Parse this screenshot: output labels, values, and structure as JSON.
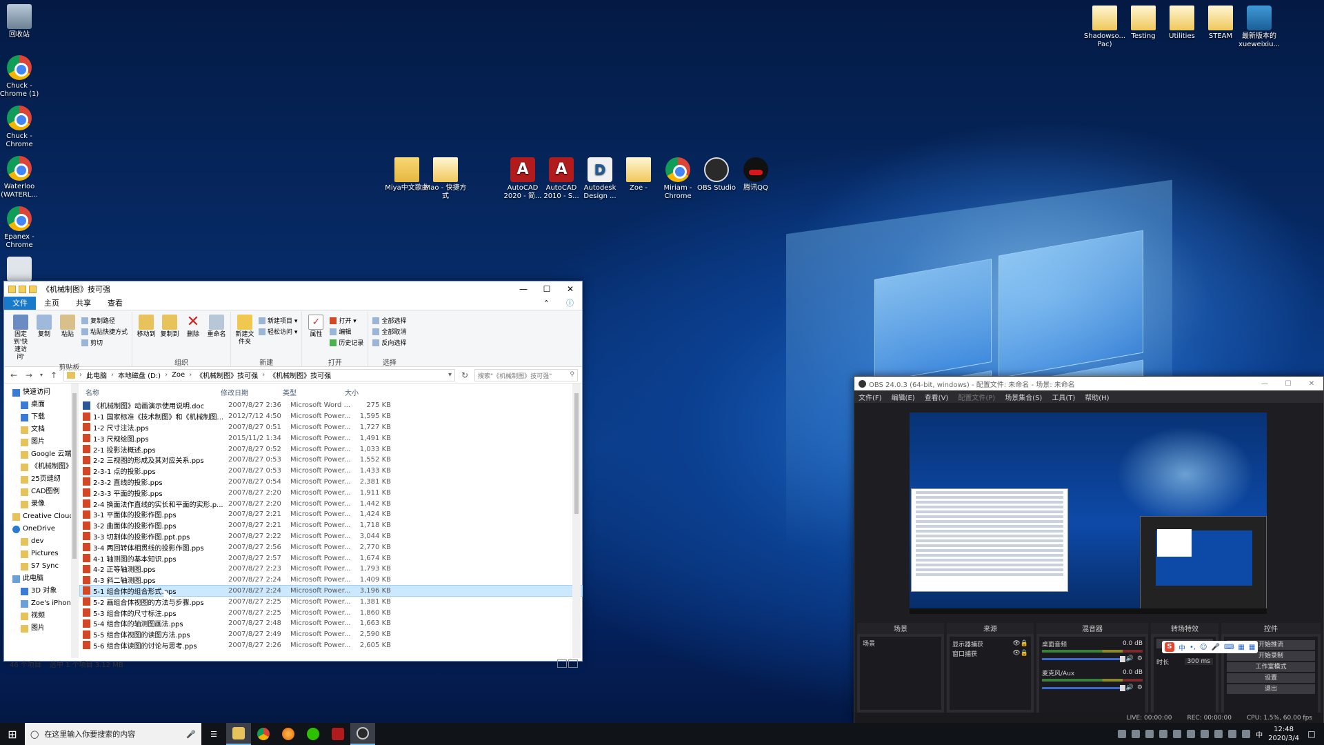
{
  "desktop_left": [
    {
      "label": "回收站",
      "icon": "recycle-bin-icon",
      "kind": "recycle"
    },
    {
      "label": "Chuck - Chrome (1)",
      "icon": "chrome-icon",
      "kind": "chrome"
    },
    {
      "label": "Chuck - Chrome",
      "icon": "chrome-icon",
      "kind": "chrome"
    },
    {
      "label": "Waterloo (WATERL...",
      "icon": "chrome-icon",
      "kind": "chrome"
    },
    {
      "label": "Epanex - Chrome",
      "icon": "chrome-icon",
      "kind": "chrome"
    },
    {
      "label": "",
      "icon": "settings-shortcut-icon",
      "kind": "gear"
    }
  ],
  "desktop_middle": [
    {
      "label": "Miya中文歌曲",
      "icon": "folder-icon",
      "kind": "folder"
    },
    {
      "label": "Mao - 快捷方式",
      "icon": "folder-shortcut-icon",
      "kind": "file"
    },
    {
      "label": "AutoCAD 2020 - 简...",
      "icon": "autocad-icon",
      "kind": "acad",
      "glyph": "A"
    },
    {
      "label": "AutoCAD 2010 - S...",
      "icon": "autocad-icon",
      "kind": "acad",
      "glyph": "A"
    },
    {
      "label": "Autodesk Design ...",
      "icon": "autodesk-design-review-icon",
      "kind": "rev",
      "glyph": "D"
    },
    {
      "label": "Zoe -",
      "icon": "folder-shortcut-icon",
      "kind": "file"
    },
    {
      "label": "Miriam - Chrome",
      "icon": "chrome-icon",
      "kind": "chrome"
    },
    {
      "label": "OBS Studio",
      "icon": "obs-icon",
      "kind": "obs"
    },
    {
      "label": "腾讯QQ",
      "icon": "qq-icon",
      "kind": "qq"
    }
  ],
  "desktop_right": [
    {
      "label": "Shadowso... Pac)",
      "icon": "folder-icon",
      "kind": "file"
    },
    {
      "label": "Testing",
      "icon": "folder-icon",
      "kind": "file"
    },
    {
      "label": "Utilities",
      "icon": "folder-icon",
      "kind": "file"
    },
    {
      "label": "STEAM",
      "icon": "folder-icon",
      "kind": "file"
    },
    {
      "label": "最新版本的xueweixiu...",
      "icon": "video-file-icon",
      "kind": "video"
    }
  ],
  "explorer": {
    "title": "《机械制图》技可强",
    "tabs": {
      "file": "文件",
      "home": "主页",
      "share": "共享",
      "view": "查看"
    },
    "ribbon": {
      "pin": "固定到'快速访问'",
      "copy": "复制",
      "paste": "粘贴",
      "copy_path": "复制路径",
      "paste_shortcut": "粘贴快捷方式",
      "cut": "剪切",
      "clipboard": "剪贴板",
      "move_to": "移动到",
      "copy_to": "复制到",
      "delete": "删除",
      "rename": "重命名",
      "organize": "组织",
      "new_folder": "新建文件夹",
      "new_item": "新建项目 ▾",
      "easy_access": "轻松访问 ▾",
      "new": "新建",
      "properties": "属性",
      "open": "打开 ▾",
      "edit": "编辑",
      "history": "历史记录",
      "open_group": "打开",
      "select_all": "全部选择",
      "select_none": "全部取消",
      "invert": "反向选择",
      "select": "选择"
    },
    "address": [
      "此电脑",
      "本地磁盘 (D:)",
      "Zoe",
      "《机械制图》技可强",
      "《机械制图》技可强"
    ],
    "search_placeholder": "搜索\"《机械制图》技可强\"",
    "nav": [
      {
        "label": "快速访问",
        "sub": false,
        "i": "blue"
      },
      {
        "label": "桌面",
        "sub": true,
        "i": "blue"
      },
      {
        "label": "下载",
        "sub": true,
        "i": "blue"
      },
      {
        "label": "文档",
        "sub": true,
        "i": ""
      },
      {
        "label": "图片",
        "sub": true,
        "i": ""
      },
      {
        "label": "Google 云端",
        "sub": true,
        "i": ""
      },
      {
        "label": "《机械制图》技",
        "sub": true,
        "i": ""
      },
      {
        "label": "25页缝纫",
        "sub": true,
        "i": ""
      },
      {
        "label": "CAD图例",
        "sub": true,
        "i": ""
      },
      {
        "label": "录像",
        "sub": true,
        "i": ""
      },
      {
        "label": "Creative Cloud F",
        "sub": false,
        "i": ""
      },
      {
        "label": "OneDrive",
        "sub": false,
        "i": "cloud"
      },
      {
        "label": "dev",
        "sub": true,
        "i": ""
      },
      {
        "label": "Pictures",
        "sub": true,
        "i": ""
      },
      {
        "label": "S7 Sync",
        "sub": true,
        "i": ""
      },
      {
        "label": "此电脑",
        "sub": false,
        "i": "pc"
      },
      {
        "label": "3D 对象",
        "sub": true,
        "i": "blue"
      },
      {
        "label": "Zoe's iPhone",
        "sub": true,
        "i": "pc"
      },
      {
        "label": "视频",
        "sub": true,
        "i": ""
      },
      {
        "label": "图片",
        "sub": true,
        "i": ""
      }
    ],
    "columns": {
      "name": "名称",
      "modified": "修改日期",
      "type": "类型",
      "size": "大小"
    },
    "files": [
      {
        "name": "《机械制图》动画演示使用说明.doc",
        "date": "2007/8/27 2:36",
        "type": "Microsoft Word ...",
        "size": "275 KB",
        "doc": true
      },
      {
        "name": "1-1 国家标准《技术制图》和《机械制图...",
        "date": "2012/7/12 4:50",
        "type": "Microsoft Power...",
        "size": "1,595 KB"
      },
      {
        "name": "1-2 尺寸注法.pps",
        "date": "2007/8/27 0:51",
        "type": "Microsoft Power...",
        "size": "1,727 KB"
      },
      {
        "name": "1-3 尺规绘图.pps",
        "date": "2015/11/2 1:34",
        "type": "Microsoft Power...",
        "size": "1,491 KB"
      },
      {
        "name": "2-1 投影法概述.pps",
        "date": "2007/8/27 0:52",
        "type": "Microsoft Power...",
        "size": "1,033 KB"
      },
      {
        "name": "2-2 三视图的形成及其对应关系.pps",
        "date": "2007/8/27 0:53",
        "type": "Microsoft Power...",
        "size": "1,552 KB"
      },
      {
        "name": "2-3-1 点的投影.pps",
        "date": "2007/8/27 0:53",
        "type": "Microsoft Power...",
        "size": "1,433 KB"
      },
      {
        "name": "2-3-2 直线的投影.pps",
        "date": "2007/8/27 0:54",
        "type": "Microsoft Power...",
        "size": "2,381 KB"
      },
      {
        "name": "2-3-3 平面的投影.pps",
        "date": "2007/8/27 2:20",
        "type": "Microsoft Power...",
        "size": "1,911 KB"
      },
      {
        "name": "2-4 换面法作直线的实长和平面的实形.p...",
        "date": "2007/8/27 2:20",
        "type": "Microsoft Power...",
        "size": "1,442 KB"
      },
      {
        "name": "3-1 平面体的投影作图.pps",
        "date": "2007/8/27 2:21",
        "type": "Microsoft Power...",
        "size": "1,424 KB"
      },
      {
        "name": "3-2 曲面体的投影作图.pps",
        "date": "2007/8/27 2:21",
        "type": "Microsoft Power...",
        "size": "1,718 KB"
      },
      {
        "name": "3-3 切割体的投影作图.ppt.pps",
        "date": "2007/8/27 2:22",
        "type": "Microsoft Power...",
        "size": "3,044 KB"
      },
      {
        "name": "3-4 两回转体相贯线的投影作图.pps",
        "date": "2007/8/27 2:56",
        "type": "Microsoft Power...",
        "size": "2,770 KB"
      },
      {
        "name": "4-1 轴测图的基本知识.pps",
        "date": "2007/8/27 2:57",
        "type": "Microsoft Power...",
        "size": "1,674 KB"
      },
      {
        "name": "4-2 正等轴测图.pps",
        "date": "2007/8/27 2:23",
        "type": "Microsoft Power...",
        "size": "1,793 KB"
      },
      {
        "name": "4-3 斜二轴测图.pps",
        "date": "2007/8/27 2:24",
        "type": "Microsoft Power...",
        "size": "1,409 KB"
      },
      {
        "name": "5-1 组合体的组合形式.pps",
        "date": "2007/8/27 2:24",
        "type": "Microsoft Power...",
        "size": "3,196 KB",
        "selected": true
      },
      {
        "name": "5-2 画组合体视图的方法与步骤.pps",
        "date": "2007/8/27 2:25",
        "type": "Microsoft Power...",
        "size": "1,381 KB"
      },
      {
        "name": "5-3 组合体的尺寸标注.pps",
        "date": "2007/8/27 2:25",
        "type": "Microsoft Power...",
        "size": "1,860 KB"
      },
      {
        "name": "5-4 组合体的轴测图画法.pps",
        "date": "2007/8/27 2:48",
        "type": "Microsoft Power...",
        "size": "1,663 KB"
      },
      {
        "name": "5-5 组合体视图的读图方法.pps",
        "date": "2007/8/27 2:49",
        "type": "Microsoft Power...",
        "size": "2,590 KB"
      },
      {
        "name": "5-6 组合体读图的讨论与思考.pps",
        "date": "2007/8/27 2:26",
        "type": "Microsoft Power...",
        "size": "2,605 KB"
      }
    ],
    "status": {
      "count": "46 个项目",
      "selected": "选中 1 个项目  3.12 MB"
    }
  },
  "obs": {
    "title": "OBS 24.0.3 (64-bit, windows) - 配置文件: 未命名 - 场景: 未命名",
    "menu": [
      "文件(F)",
      "编辑(E)",
      "查看(V)",
      "配置文件(P)",
      "场景集合(S)",
      "工具(T)",
      "帮助(H)"
    ],
    "docks": {
      "scenes": "场景",
      "sources": "来源",
      "mixer": "混音器",
      "transitions": "转场特效",
      "controls": "控件"
    },
    "scene_item": "场景",
    "sources": [
      "显示器捕获",
      "窗口捕获"
    ],
    "mixer": [
      {
        "name": "桌面音频",
        "db": "0.0 dB"
      },
      {
        "name": "麦克风/Aux",
        "db": "0.0 dB"
      }
    ],
    "transition_duration_label": "时长",
    "transition_duration": "300 ms",
    "controls": [
      "开始推流",
      "开始录制",
      "工作室模式",
      "设置",
      "退出"
    ],
    "status": {
      "live": "LIVE: 00:00:00",
      "rec": "REC: 00:00:00",
      "cpu": "CPU: 1.5%, 60.00 fps"
    }
  },
  "taskbar": {
    "search_placeholder": "在这里输入你要搜索的内容",
    "time": "12:48",
    "date": "2020/3/4"
  }
}
